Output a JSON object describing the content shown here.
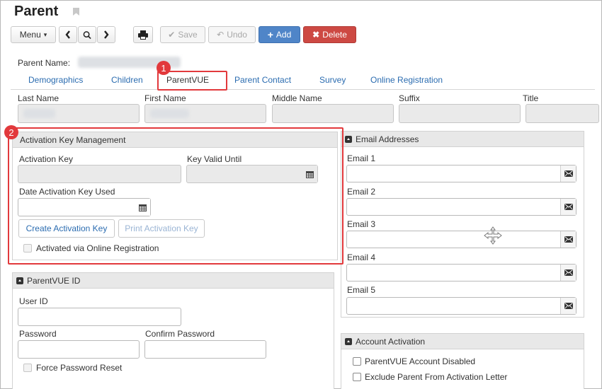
{
  "page": {
    "title": "Parent"
  },
  "toolbar": {
    "menu_label": "Menu",
    "save_label": "Save",
    "undo_label": "Undo",
    "add_label": "Add",
    "delete_label": "Delete"
  },
  "parent_name_label": "Parent Name:",
  "tabs": [
    {
      "label": "Demographics"
    },
    {
      "label": "Children"
    },
    {
      "label": "ParentVUE"
    },
    {
      "label": "Parent Contact"
    },
    {
      "label": "Survey"
    },
    {
      "label": "Online Registration"
    }
  ],
  "name_fields": {
    "last_name": "Last Name",
    "first_name": "First Name",
    "middle_name": "Middle Name",
    "suffix": "Suffix",
    "title": "Title"
  },
  "activation_panel": {
    "title": "Activation Key Management",
    "activation_key_label": "Activation Key",
    "key_valid_until_label": "Key Valid Until",
    "date_used_label": "Date Activation Key Used",
    "create_button": "Create Activation Key",
    "print_button": "Print Activation Key",
    "activated_online_label": "Activated via Online Registration"
  },
  "parentvue_panel": {
    "title": "ParentVUE ID",
    "user_id_label": "User ID",
    "password_label": "Password",
    "confirm_password_label": "Confirm Password",
    "force_reset_label": "Force Password Reset"
  },
  "email_panel": {
    "title": "Email Addresses",
    "emails": [
      {
        "label": "Email 1"
      },
      {
        "label": "Email 2"
      },
      {
        "label": "Email 3"
      },
      {
        "label": "Email 4"
      },
      {
        "label": "Email 5"
      }
    ]
  },
  "account_panel": {
    "title": "Account Activation",
    "disabled_label": "ParentVUE Account Disabled",
    "exclude_label": "Exclude Parent From Activation Letter"
  },
  "callouts": [
    "1",
    "2"
  ],
  "colors": {
    "accent": "#2b6cb0",
    "add": "#4f85c8",
    "delete": "#cd4943",
    "callout": "#e2393c"
  }
}
